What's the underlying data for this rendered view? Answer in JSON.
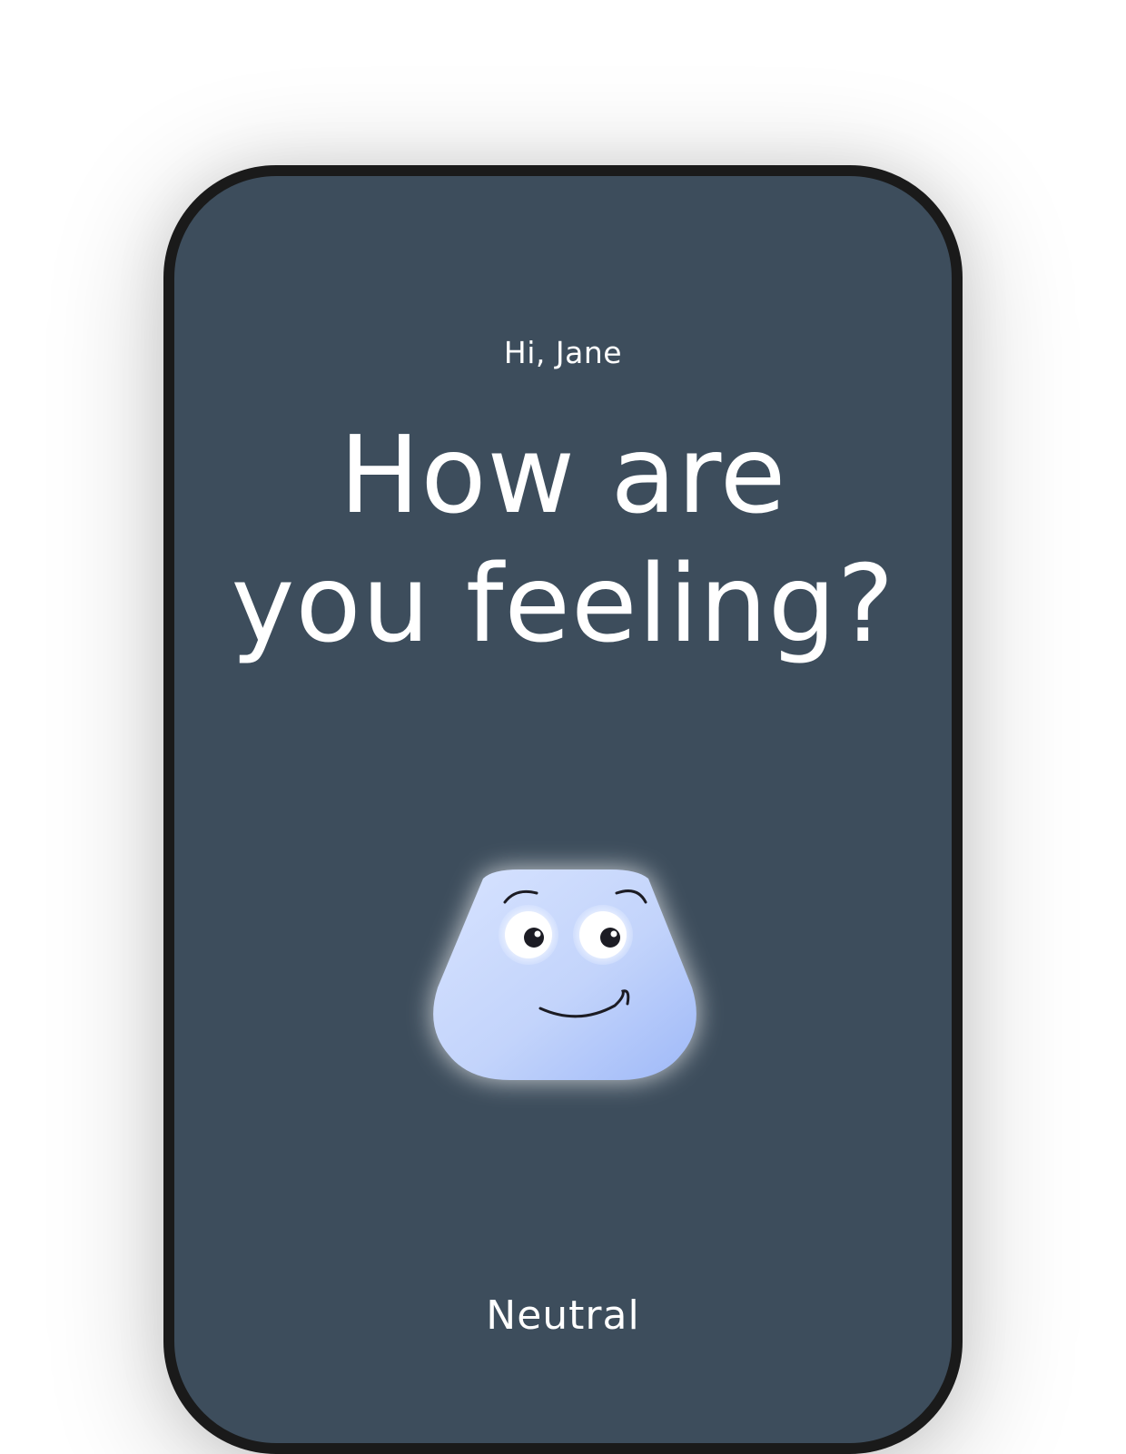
{
  "greeting": "Hi, Jane",
  "headline": {
    "line1": "How are",
    "line2": "you feeling?"
  },
  "mascot": {
    "icon": "neutral-face-blob-icon",
    "body_color": "#c3d4fb",
    "body_edge_color": "#9fb9f8",
    "glow_color": "#ffffff"
  },
  "mood": {
    "label": "Neutral"
  },
  "colors": {
    "screen_background": "#3d4d5c",
    "phone_frame": "#1a1a1a",
    "text": "#ffffff"
  }
}
